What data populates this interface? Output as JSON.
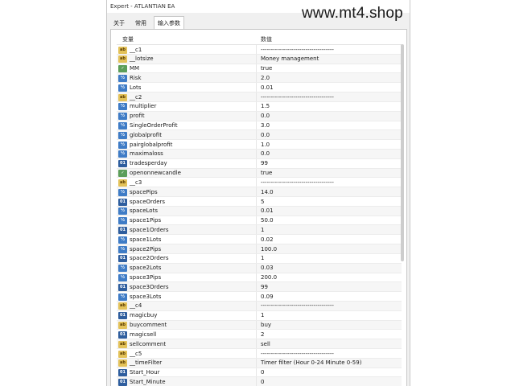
{
  "window": {
    "title": "Expert - ATLANTIAN EA",
    "watermark": "www.mt4.shop"
  },
  "tabs": [
    {
      "label": "关于",
      "active": false
    },
    {
      "label": "常用",
      "active": false
    },
    {
      "label": "输入参数",
      "active": true
    }
  ],
  "table": {
    "col_name": "变量",
    "col_value": "数值",
    "rows": [
      {
        "icon": "ab",
        "name": "__c1",
        "value": "------------------------------------"
      },
      {
        "icon": "ab",
        "name": "__lotsize",
        "value": "Money management"
      },
      {
        "icon": "bool",
        "name": "MM",
        "value": "true"
      },
      {
        "icon": "v2",
        "name": "Risk",
        "value": "2.0"
      },
      {
        "icon": "v2",
        "name": "Lots",
        "value": "0.01"
      },
      {
        "icon": "ab",
        "name": "__c2",
        "value": "------------------------------------"
      },
      {
        "icon": "v2",
        "name": "multiplier",
        "value": "1.5"
      },
      {
        "icon": "v2",
        "name": "profit",
        "value": "0.0"
      },
      {
        "icon": "v2",
        "name": "SingleOrderProfit",
        "value": "3.0"
      },
      {
        "icon": "v2",
        "name": "globalprofit",
        "value": "0.0"
      },
      {
        "icon": "v2",
        "name": "pairglobalprofit",
        "value": "1.0"
      },
      {
        "icon": "v2",
        "name": "maximaloss",
        "value": "0.0"
      },
      {
        "icon": "int",
        "name": "tradesperday",
        "value": "99"
      },
      {
        "icon": "bool",
        "name": "openonnewcandle",
        "value": "true"
      },
      {
        "icon": "ab",
        "name": "__c3",
        "value": "------------------------------------"
      },
      {
        "icon": "v2",
        "name": "spacePips",
        "value": "14.0"
      },
      {
        "icon": "int",
        "name": "spaceOrders",
        "value": "5"
      },
      {
        "icon": "v2",
        "name": "spaceLots",
        "value": "0.01"
      },
      {
        "icon": "v2",
        "name": "space1Pips",
        "value": "50.0"
      },
      {
        "icon": "int",
        "name": "space1Orders",
        "value": "1"
      },
      {
        "icon": "v2",
        "name": "space1Lots",
        "value": "0.02"
      },
      {
        "icon": "v2",
        "name": "space2Pips",
        "value": "100.0"
      },
      {
        "icon": "int",
        "name": "space2Orders",
        "value": "1"
      },
      {
        "icon": "v2",
        "name": "space2Lots",
        "value": "0.03"
      },
      {
        "icon": "v2",
        "name": "space3Pips",
        "value": "200.0"
      },
      {
        "icon": "int",
        "name": "space3Orders",
        "value": "99"
      },
      {
        "icon": "v2",
        "name": "space3Lots",
        "value": "0.09"
      },
      {
        "icon": "ab",
        "name": "__c4",
        "value": "------------------------------------"
      },
      {
        "icon": "int",
        "name": "magicbuy",
        "value": "1"
      },
      {
        "icon": "ab",
        "name": "buycomment",
        "value": "buy"
      },
      {
        "icon": "int",
        "name": "magicsell",
        "value": "2"
      },
      {
        "icon": "ab",
        "name": "sellcomment",
        "value": "sell"
      },
      {
        "icon": "ab",
        "name": "__c5",
        "value": "------------------------------------"
      },
      {
        "icon": "ab",
        "name": "__timeFilter",
        "value": "Timer filter (Hour 0-24 Minute 0-59)"
      },
      {
        "icon": "int",
        "name": "Start_Hour",
        "value": "0"
      },
      {
        "icon": "int",
        "name": "Start_Minute",
        "value": "0"
      }
    ]
  },
  "icon_labels": {
    "ab": "ab",
    "bool": "✓",
    "v2": "½",
    "int": "01"
  }
}
